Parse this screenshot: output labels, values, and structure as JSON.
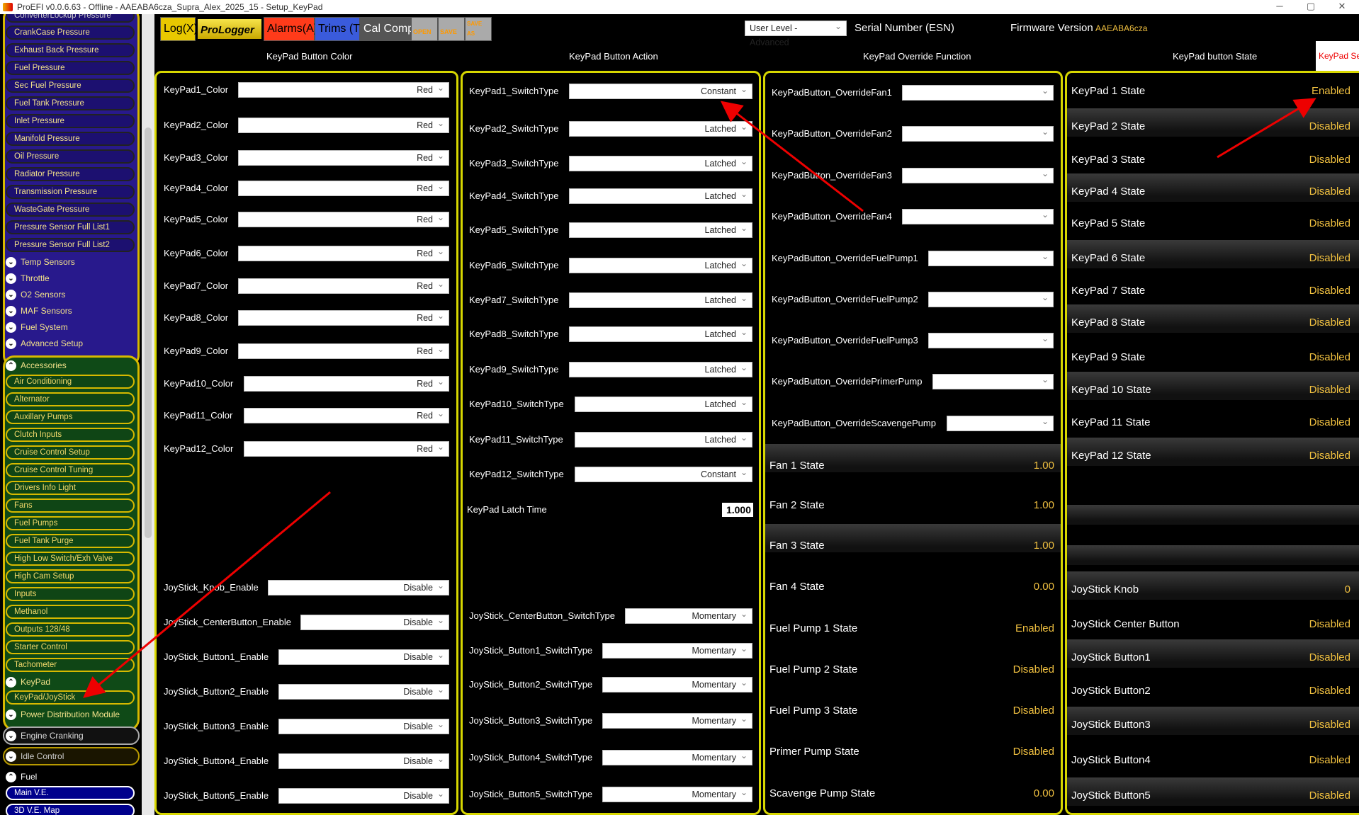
{
  "window": {
    "title": "ProEFI v0.0.6.63 - Offline - AAEABA6cza_Supra_Alex_2025_15 - Setup_KeyPad",
    "minimize": "─",
    "maximize": "▢",
    "close": "✕"
  },
  "sidebar": {
    "cut_item": "ConverterLockup Pressure",
    "pressure_items": [
      "CrankCase Pressure",
      "Exhaust Back Pressure",
      "Fuel Pressure",
      "Sec Fuel Pressure",
      "Fuel Tank Pressure",
      "Inlet Pressure",
      "Manifold Pressure",
      "Oil Pressure",
      "Radiator Pressure",
      "Transmission Pressure",
      "WasteGate Pressure",
      "Pressure Sensor Full List1",
      "Pressure Sensor Full List2"
    ],
    "sections": [
      "Temp Sensors",
      "Throttle",
      "O2 Sensors",
      "MAF Sensors",
      "Fuel System",
      "Advanced Setup"
    ],
    "accessories_label": "Accessories",
    "accessory_items": [
      "Air Conditioning",
      "Alternator",
      "Auxillary Pumps",
      "Clutch Inputs",
      "Cruise Control Setup",
      "Cruise Control Tuning",
      "Drivers Info Light",
      "Fans",
      "Fuel Pumps",
      "Fuel Tank Purge",
      "High Low Switch/Exh Valve",
      "High Cam Setup",
      "Inputs",
      "Methanol",
      "Outputs 128/48",
      "Starter Control",
      "Tachometer"
    ],
    "keypad_label": "KeyPad",
    "keypad_item": "KeyPad/JoyStick",
    "pdm_label": "Power Distribution Module",
    "engine_cranking": "Engine Cranking",
    "idle_control": "Idle Control",
    "fuel_label": "Fuel",
    "fuel_items": [
      "Main V.E.",
      "3D V.E. Map"
    ]
  },
  "toolbar": {
    "log": "Log(X)",
    "prologger": "ProLogger",
    "alarms": "Alarms(A)",
    "trims": "Trims (T)",
    "calcomp": "Cal Comp",
    "open": "OPEN",
    "save": "SAVE",
    "save_as": "SAVE AS"
  },
  "header": {
    "user_level": "User Level - Advanced",
    "serial_label": "Serial Number (ESN)",
    "firmware_label": "Firmware Version",
    "firmware_value": "AAEABA6cza"
  },
  "columns": {
    "color": "KeyPad Button Color",
    "action": "KeyPad Button Action",
    "override": "KeyPad Override Function",
    "state": "KeyPad button State",
    "tab": "KeyPad Setup"
  },
  "color_rows": [
    {
      "label": "KeyPad1_Color",
      "value": "Red"
    },
    {
      "label": "KeyPad2_Color",
      "value": "Red"
    },
    {
      "label": "KeyPad3_Color",
      "value": "Red"
    },
    {
      "label": "KeyPad4_Color",
      "value": "Red"
    },
    {
      "label": "KeyPad5_Color",
      "value": "Red"
    },
    {
      "label": "KeyPad6_Color",
      "value": "Red"
    },
    {
      "label": "KeyPad7_Color",
      "value": "Red"
    },
    {
      "label": "KeyPad8_Color",
      "value": "Red"
    },
    {
      "label": "KeyPad9_Color",
      "value": "Red"
    },
    {
      "label": "KeyPad10_Color",
      "value": "Red"
    },
    {
      "label": "KeyPad11_Color",
      "value": "Red"
    },
    {
      "label": "KeyPad12_Color",
      "value": "Red"
    }
  ],
  "joystick_enable_rows": [
    {
      "label": "JoyStick_Knob_Enable",
      "value": "Disable"
    },
    {
      "label": "JoyStick_CenterButton_Enable",
      "value": "Disable"
    },
    {
      "label": "JoyStick_Button1_Enable",
      "value": "Disable"
    },
    {
      "label": "JoyStick_Button2_Enable",
      "value": "Disable"
    },
    {
      "label": "JoyStick_Button3_Enable",
      "value": "Disable"
    },
    {
      "label": "JoyStick_Button4_Enable",
      "value": "Disable"
    },
    {
      "label": "JoyStick_Button5_Enable",
      "value": "Disable"
    }
  ],
  "switch_rows": [
    {
      "label": "KeyPad1_SwitchType",
      "value": "Constant"
    },
    {
      "label": "KeyPad2_SwitchType",
      "value": "Latched"
    },
    {
      "label": "KeyPad3_SwitchType",
      "value": "Latched"
    },
    {
      "label": "KeyPad4_SwitchType",
      "value": "Latched"
    },
    {
      "label": "KeyPad5_SwitchType",
      "value": "Latched"
    },
    {
      "label": "KeyPad6_SwitchType",
      "value": "Latched"
    },
    {
      "label": "KeyPad7_SwitchType",
      "value": "Latched"
    },
    {
      "label": "KeyPad8_SwitchType",
      "value": "Latched"
    },
    {
      "label": "KeyPad9_SwitchType",
      "value": "Latched"
    },
    {
      "label": "KeyPad10_SwitchType",
      "value": "Latched"
    },
    {
      "label": "KeyPad11_SwitchType",
      "value": "Latched"
    },
    {
      "label": "KeyPad12_SwitchType",
      "value": "Constant"
    }
  ],
  "latch_time": {
    "label": "KeyPad Latch Time",
    "value": "1.000"
  },
  "joystick_switch_rows": [
    {
      "label": "JoyStick_CenterButton_SwitchType",
      "value": "Momentary"
    },
    {
      "label": "JoyStick_Button1_SwitchType",
      "value": "Momentary"
    },
    {
      "label": "JoyStick_Button2_SwitchType",
      "value": "Momentary"
    },
    {
      "label": "JoyStick_Button3_SwitchType",
      "value": "Momentary"
    },
    {
      "label": "JoyStick_Button4_SwitchType",
      "value": "Momentary"
    },
    {
      "label": "JoyStick_Button5_SwitchType",
      "value": "Momentary"
    }
  ],
  "override_rows": [
    {
      "label": "KeyPadButton_OverrideFan1",
      "value": ""
    },
    {
      "label": "KeyPadButton_OverrideFan2",
      "value": ""
    },
    {
      "label": "KeyPadButton_OverrideFan3",
      "value": ""
    },
    {
      "label": "KeyPadButton_OverrideFan4",
      "value": ""
    },
    {
      "label": "KeyPadButton_OverrideFuelPump1",
      "value": ""
    },
    {
      "label": "KeyPadButton_OverrideFuelPump2",
      "value": ""
    },
    {
      "label": "KeyPadButton_OverrideFuelPump3",
      "value": ""
    },
    {
      "label": "KeyPadButton_OverridePrimerPump",
      "value": ""
    },
    {
      "label": "KeyPadButton_OverrideScavengePump",
      "value": ""
    }
  ],
  "override_states": [
    {
      "label": "Fan 1 State",
      "value": "1.00"
    },
    {
      "label": "Fan 2 State",
      "value": "1.00"
    },
    {
      "label": "Fan 3 State",
      "value": "1.00"
    },
    {
      "label": "Fan 4 State",
      "value": "0.00"
    },
    {
      "label": "Fuel Pump 1 State",
      "value": "Enabled"
    },
    {
      "label": "Fuel Pump 2 State",
      "value": "Disabled"
    },
    {
      "label": "Fuel Pump 3 State",
      "value": "Disabled"
    },
    {
      "label": "Primer Pump State",
      "value": "Disabled"
    },
    {
      "label": "Scavenge Pump State",
      "value": "0.00"
    }
  ],
  "keypad_states": [
    {
      "label": "KeyPad 1 State",
      "value": "Enabled"
    },
    {
      "label": "KeyPad 2 State",
      "value": "Disabled"
    },
    {
      "label": "KeyPad 3 State",
      "value": "Disabled"
    },
    {
      "label": "KeyPad 4 State",
      "value": "Disabled"
    },
    {
      "label": "KeyPad 5 State",
      "value": "Disabled"
    },
    {
      "label": "KeyPad 6 State",
      "value": "Disabled"
    },
    {
      "label": "KeyPad 7 State",
      "value": "Disabled"
    },
    {
      "label": "KeyPad 8 State",
      "value": "Disabled"
    },
    {
      "label": "KeyPad 9 State",
      "value": "Disabled"
    },
    {
      "label": "KeyPad 10 State",
      "value": "Disabled"
    },
    {
      "label": "KeyPad 11 State",
      "value": "Disabled"
    },
    {
      "label": "KeyPad 12 State",
      "value": "Disabled"
    }
  ],
  "joystick_states": [
    {
      "label": "JoyStick Knob",
      "value": "0"
    },
    {
      "label": "JoyStick Center Button",
      "value": "Disabled"
    },
    {
      "label": "JoyStick Button1",
      "value": "Disabled"
    },
    {
      "label": "JoyStick Button2",
      "value": "Disabled"
    },
    {
      "label": "JoyStick Button3",
      "value": "Disabled"
    },
    {
      "label": "JoyStick Button4",
      "value": "Disabled"
    },
    {
      "label": "JoyStick Button5",
      "value": "Disabled"
    }
  ],
  "colors": {
    "panel_border": "#d7d700",
    "value_text": "#f0c040",
    "sidebar_purple": "#28198c",
    "sidebar_green": "#0f4a17",
    "annotation_arrow": "#e00000"
  }
}
